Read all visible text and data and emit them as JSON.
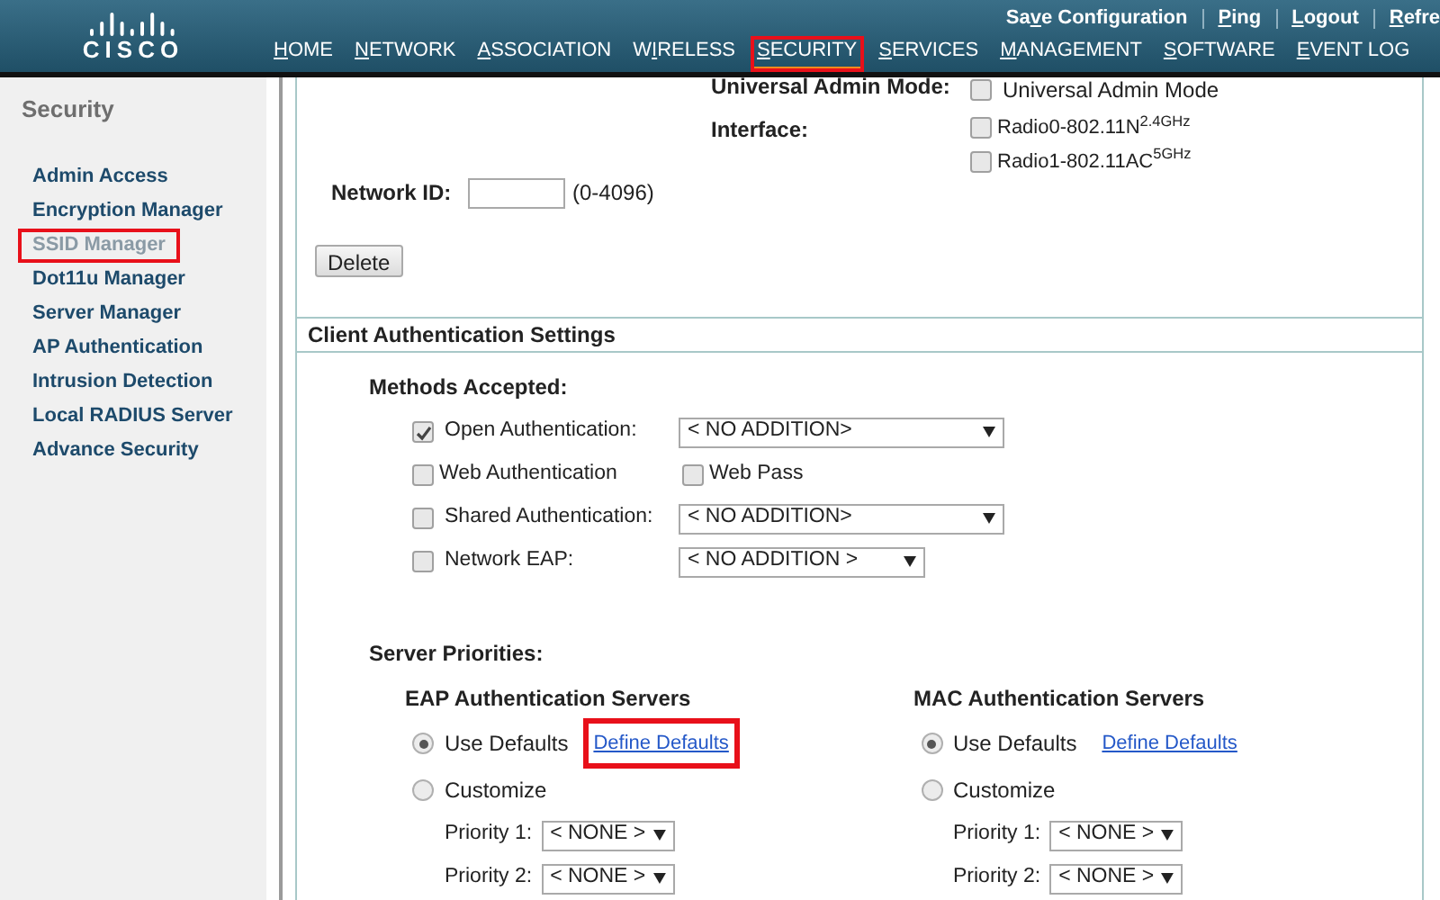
{
  "header": {
    "logo": "CISCO",
    "top_links": [
      {
        "pre": "Sa",
        "key": "v",
        "post": "e Configuration"
      },
      {
        "key": "P",
        "post": "ing"
      },
      {
        "key": "L",
        "post": "ogout"
      },
      {
        "key": "R",
        "post": "efre"
      }
    ],
    "nav": [
      {
        "key": "H",
        "post": "OME",
        "selected": false,
        "annotated": false
      },
      {
        "key": "N",
        "post": "ETWORK",
        "selected": false,
        "annotated": false
      },
      {
        "key": "A",
        "post": "SSOCIATION",
        "selected": false,
        "annotated": false
      },
      {
        "pre": "W",
        "key": "I",
        "post": "RELESS",
        "selected": false,
        "annotated": false
      },
      {
        "key": "S",
        "post": "ECURITY",
        "selected": true,
        "annotated": true
      },
      {
        "key": "S",
        "post": "ERVICES",
        "selected": false,
        "annotated": false
      },
      {
        "key": "M",
        "post": "ANAGEMENT",
        "selected": false,
        "annotated": false
      },
      {
        "key": "S",
        "post": "OFTWARE",
        "selected": false,
        "annotated": false
      },
      {
        "key": "E",
        "post": "VENT LOG",
        "selected": false,
        "annotated": false
      }
    ]
  },
  "sidebar": {
    "title": "Security",
    "items": [
      {
        "label": "Admin Access",
        "selected": false,
        "annotated": false
      },
      {
        "label": "Encryption Manager",
        "selected": false,
        "annotated": false
      },
      {
        "label": "SSID Manager",
        "selected": true,
        "annotated": true
      },
      {
        "label": "Dot11u Manager",
        "selected": false,
        "annotated": false
      },
      {
        "label": "Server Manager",
        "selected": false,
        "annotated": false
      },
      {
        "label": "AP Authentication",
        "selected": false,
        "annotated": false
      },
      {
        "label": "Intrusion Detection",
        "selected": false,
        "annotated": false
      },
      {
        "label": "Local RADIUS Server",
        "selected": false,
        "annotated": false
      },
      {
        "label": "Advance Security",
        "selected": false,
        "annotated": false
      }
    ]
  },
  "universal_admin": {
    "label": "Universal Admin Mode:",
    "option": "Universal Admin Mode",
    "checked": false
  },
  "interface": {
    "label": "Interface:",
    "options": [
      {
        "label": "Radio0-802.11N$^{2.4GHz}$",
        "checked": false
      },
      {
        "label": "Radio1-802.11AC$^{5GHz}$",
        "checked": false
      }
    ]
  },
  "network_id": {
    "label": "Network ID:",
    "hint": "(0-4096)"
  },
  "delete_button": "Delete",
  "client_auth": {
    "title": "Client Authentication Settings",
    "methods_label": "Methods Accepted:",
    "methods": [
      {
        "kind": "select",
        "label": "Open Authentication:",
        "checked": true,
        "value": "< NO ADDITION>",
        "wide": true
      },
      {
        "kind": "pair",
        "label": "Web Authentication",
        "checked": false,
        "second_label": "Web Pass",
        "second_checked": false
      },
      {
        "kind": "select",
        "label": "Shared Authentication:",
        "checked": false,
        "value": "< NO ADDITION>",
        "wide": true
      },
      {
        "kind": "select",
        "label": "Network EAP:",
        "checked": false,
        "value": "< NO ADDITION >",
        "wide": false
      }
    ],
    "server_priorities": "Server Priorities:",
    "server_groups": [
      {
        "title": "EAP Authentication Servers",
        "options": [
          {
            "label": "Use Defaults",
            "selected": true
          },
          {
            "label": "Customize",
            "selected": false
          }
        ],
        "link": "Define Defaults",
        "link_annotated": true,
        "priorities": [
          {
            "label": "Priority 1:",
            "value": "< NONE >"
          },
          {
            "label": "Priority 2:",
            "value": "< NONE >"
          }
        ]
      },
      {
        "title": "MAC Authentication Servers",
        "options": [
          {
            "label": "Use Defaults",
            "selected": true
          },
          {
            "label": "Customize",
            "selected": false
          }
        ],
        "link": "Define Defaults",
        "link_annotated": false,
        "priorities": [
          {
            "label": "Priority 1:",
            "value": "< NONE >"
          },
          {
            "label": "Priority 2:",
            "value": "< NONE >"
          }
        ]
      }
    ]
  }
}
